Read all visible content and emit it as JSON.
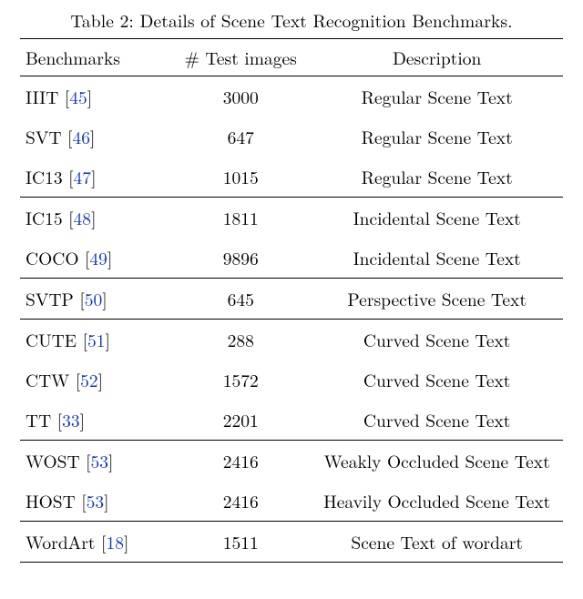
{
  "caption": "Table 2: Details of Scene Text Recognition Benchmarks.",
  "headers": {
    "c0": "Benchmarks",
    "c1": "# Test images",
    "c2": "Description"
  },
  "groups": [
    {
      "rows": [
        {
          "name": "IIIT",
          "cite": "45",
          "n": "3000",
          "desc": "Regular Scene Text"
        },
        {
          "name": "SVT",
          "cite": "46",
          "n": "647",
          "desc": "Regular Scene Text"
        },
        {
          "name": "IC13",
          "cite": "47",
          "n": "1015",
          "desc": "Regular Scene Text"
        }
      ]
    },
    {
      "rows": [
        {
          "name": "IC15",
          "cite": "48",
          "n": "1811",
          "desc": "Incidental Scene Text"
        },
        {
          "name": "COCO",
          "cite": "49",
          "n": "9896",
          "desc": "Incidental Scene Text"
        }
      ]
    },
    {
      "rows": [
        {
          "name": "SVTP",
          "cite": "50",
          "n": "645",
          "desc": "Perspective Scene Text"
        }
      ]
    },
    {
      "rows": [
        {
          "name": "CUTE",
          "cite": "51",
          "n": "288",
          "desc": "Curved Scene Text"
        },
        {
          "name": "CTW",
          "cite": "52",
          "n": "1572",
          "desc": "Curved Scene Text"
        },
        {
          "name": "TT",
          "cite": "33",
          "n": "2201",
          "desc": "Curved Scene Text"
        }
      ]
    },
    {
      "rows": [
        {
          "name": "WOST",
          "cite": "53",
          "n": "2416",
          "desc": "Weakly Occluded Scene Text"
        },
        {
          "name": "HOST",
          "cite": "53",
          "n": "2416",
          "desc": "Heavily Occluded Scene Text"
        }
      ]
    },
    {
      "rows": [
        {
          "name": "WordArt",
          "cite": "18",
          "n": "1511",
          "desc": "Scene Text of wordart"
        }
      ]
    }
  ],
  "chart_data": {
    "type": "table",
    "title": "Details of Scene Text Recognition Benchmarks.",
    "columns": [
      "Benchmarks",
      "# Test images",
      "Description"
    ],
    "rows": [
      [
        "IIIT [45]",
        3000,
        "Regular Scene Text"
      ],
      [
        "SVT [46]",
        647,
        "Regular Scene Text"
      ],
      [
        "IC13 [47]",
        1015,
        "Regular Scene Text"
      ],
      [
        "IC15 [48]",
        1811,
        "Incidental Scene Text"
      ],
      [
        "COCO [49]",
        9896,
        "Incidental Scene Text"
      ],
      [
        "SVTP [50]",
        645,
        "Perspective Scene Text"
      ],
      [
        "CUTE [51]",
        288,
        "Curved Scene Text"
      ],
      [
        "CTW [52]",
        1572,
        "Curved Scene Text"
      ],
      [
        "TT [33]",
        2201,
        "Curved Scene Text"
      ],
      [
        "WOST [53]",
        2416,
        "Weakly Occluded Scene Text"
      ],
      [
        "HOST [53]",
        2416,
        "Heavily Occluded Scene Text"
      ],
      [
        "WordArt [18]",
        1511,
        "Scene Text of wordart"
      ]
    ]
  }
}
